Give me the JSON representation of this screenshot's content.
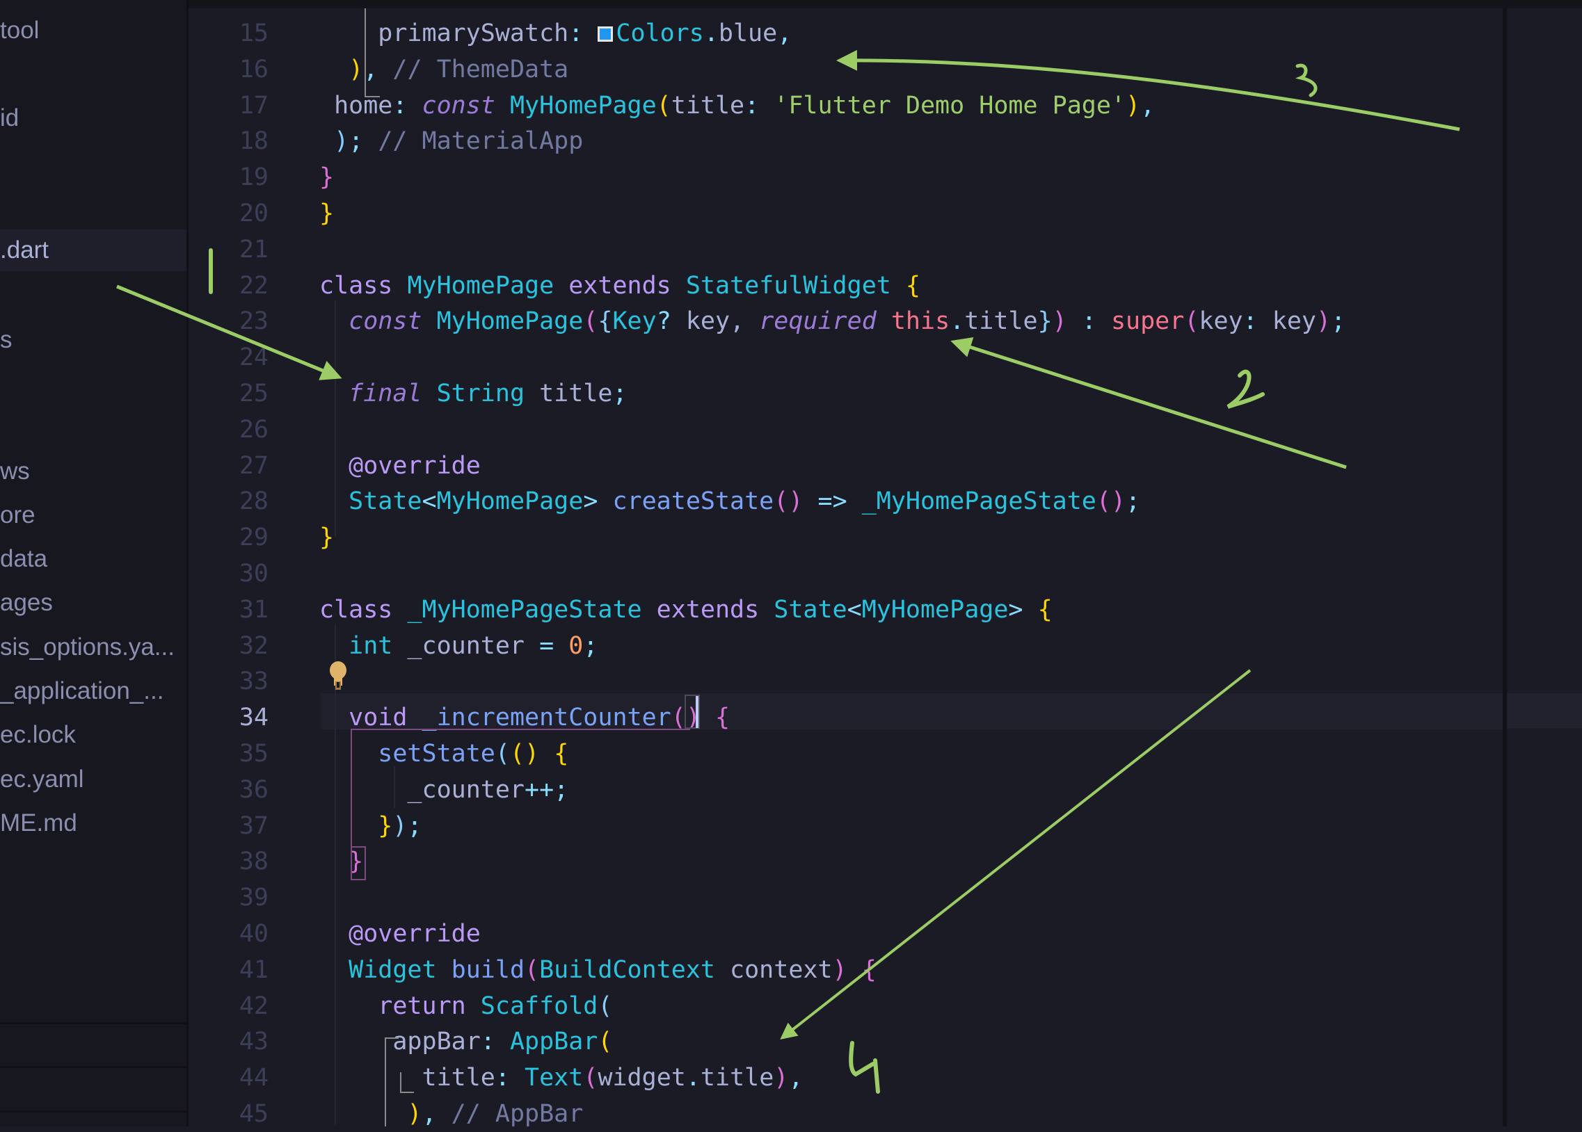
{
  "sidebar": {
    "items": [
      {
        "label": "tool",
        "selected": false
      },
      {
        "label": "id",
        "selected": false
      },
      {
        "label": ".dart",
        "selected": true
      },
      {
        "label": "s",
        "selected": false
      },
      {
        "label": "ws",
        "selected": false
      },
      {
        "label": "ore",
        "selected": false
      },
      {
        "label": "data",
        "selected": false
      },
      {
        "label": "ages",
        "selected": false
      },
      {
        "label": "sis_options.ya...",
        "selected": false
      },
      {
        "label": "_application_...",
        "selected": false
      },
      {
        "label": "ec.lock",
        "selected": false
      },
      {
        "label": "ec.yaml",
        "selected": false
      },
      {
        "label": "ME.md",
        "selected": false
      }
    ]
  },
  "editor": {
    "current_line": 34,
    "lines": [
      {
        "n": "15"
      },
      {
        "n": "16"
      },
      {
        "n": "17"
      },
      {
        "n": "18"
      },
      {
        "n": "19"
      },
      {
        "n": "20"
      },
      {
        "n": "21"
      },
      {
        "n": "22"
      },
      {
        "n": "23"
      },
      {
        "n": "24"
      },
      {
        "n": "25"
      },
      {
        "n": "26"
      },
      {
        "n": "27"
      },
      {
        "n": "28"
      },
      {
        "n": "29"
      },
      {
        "n": "30"
      },
      {
        "n": "31"
      },
      {
        "n": "32"
      },
      {
        "n": "33"
      },
      {
        "n": "34"
      },
      {
        "n": "35"
      },
      {
        "n": "36"
      },
      {
        "n": "37"
      },
      {
        "n": "38"
      },
      {
        "n": "39"
      },
      {
        "n": "40"
      },
      {
        "n": "41"
      },
      {
        "n": "42"
      },
      {
        "n": "43"
      },
      {
        "n": "44"
      },
      {
        "n": "45"
      }
    ],
    "code": {
      "l15": [
        [
          "",
          "    primarySwatch"
        ],
        [
          "pn",
          ": "
        ],
        [
          "swatch",
          ""
        ],
        [
          "ty",
          "Colors"
        ],
        [
          "pn",
          "."
        ],
        [
          "",
          "blue"
        ],
        [
          "pn",
          ","
        ]
      ],
      "l16": [
        [
          "p1",
          "  )"
        ],
        [
          "pn",
          ", "
        ],
        [
          "cm",
          "// ThemeData"
        ]
      ],
      "l17": [
        [
          "",
          " home"
        ],
        [
          "pn",
          ": "
        ],
        [
          "kwi",
          "const"
        ],
        [
          "",
          " "
        ],
        [
          "ty",
          "MyHomePage"
        ],
        [
          "p1",
          "("
        ],
        [
          "",
          "title"
        ],
        [
          "pn",
          ": "
        ],
        [
          "str",
          "'Flutter Demo Home Page'"
        ],
        [
          "p1",
          ")"
        ],
        [
          "pn",
          ","
        ]
      ],
      "l18": [
        [
          "p3",
          " )"
        ],
        [
          "pn",
          "; "
        ],
        [
          "cm",
          "// MaterialApp"
        ]
      ],
      "l19": [
        [
          "p2",
          "}"
        ]
      ],
      "l20": [
        [
          "p1",
          "}"
        ]
      ],
      "l21": [],
      "l22": [
        [
          "kw",
          "class"
        ],
        [
          "",
          " "
        ],
        [
          "ty",
          "MyHomePage"
        ],
        [
          "",
          " "
        ],
        [
          "kw",
          "extends"
        ],
        [
          "",
          " "
        ],
        [
          "ty",
          "StatefulWidget"
        ],
        [
          "",
          " "
        ],
        [
          "p1",
          "{"
        ]
      ],
      "l23": [
        [
          "kwi",
          "  const"
        ],
        [
          "",
          " "
        ],
        [
          "ty",
          "MyHomePage"
        ],
        [
          "p2",
          "("
        ],
        [
          "p3",
          "{"
        ],
        [
          "ty",
          "Key"
        ],
        [
          "pn",
          "?"
        ],
        [
          "",
          " key, "
        ],
        [
          "kwi",
          "required"
        ],
        [
          "",
          " "
        ],
        [
          "red",
          "this"
        ],
        [
          "pn",
          "."
        ],
        [
          "",
          "title"
        ],
        [
          "p3",
          "}"
        ],
        [
          "p2",
          ")"
        ],
        [
          "pn",
          " : "
        ],
        [
          "red",
          "super"
        ],
        [
          "p2",
          "("
        ],
        [
          "",
          "key"
        ],
        [
          "pn",
          ": "
        ],
        [
          "",
          "key"
        ],
        [
          "p2",
          ")"
        ],
        [
          "pn",
          ";"
        ]
      ],
      "l24": [],
      "l25": [
        [
          "kwi",
          "  final"
        ],
        [
          "",
          " "
        ],
        [
          "ty",
          "String"
        ],
        [
          "",
          " title"
        ],
        [
          "pn",
          ";"
        ]
      ],
      "l26": [],
      "l27": [
        [
          "kw",
          "  @override"
        ]
      ],
      "l28": [
        [
          "ty",
          "  State"
        ],
        [
          "pn",
          "<"
        ],
        [
          "ty",
          "MyHomePage"
        ],
        [
          "pn",
          ">"
        ],
        [
          "",
          " "
        ],
        [
          "fn",
          "createState"
        ],
        [
          "p2",
          "()"
        ],
        [
          "pn",
          " => "
        ],
        [
          "ty",
          "_MyHomePageState"
        ],
        [
          "p2",
          "()"
        ],
        [
          "pn",
          ";"
        ]
      ],
      "l29": [
        [
          "p1",
          "}"
        ]
      ],
      "l30": [],
      "l31": [
        [
          "kw",
          "class"
        ],
        [
          "",
          " "
        ],
        [
          "ty",
          "_MyHomePageState"
        ],
        [
          "",
          " "
        ],
        [
          "kw",
          "extends"
        ],
        [
          "",
          " "
        ],
        [
          "ty",
          "State"
        ],
        [
          "pn",
          "<"
        ],
        [
          "ty",
          "MyHomePage"
        ],
        [
          "pn",
          ">"
        ],
        [
          "",
          " "
        ],
        [
          "p1",
          "{"
        ]
      ],
      "l32": [
        [
          "ty",
          "  int"
        ],
        [
          "",
          " _counter "
        ],
        [
          "pn",
          "="
        ],
        [
          "",
          " "
        ],
        [
          "num",
          "0"
        ],
        [
          "pn",
          ";"
        ]
      ],
      "l33": [],
      "l34": [
        [
          "kw",
          "  void"
        ],
        [
          "",
          " "
        ],
        [
          "fn",
          "_incrementCounter"
        ],
        [
          "p2",
          "()"
        ],
        [
          "",
          " "
        ],
        [
          "p2",
          "{"
        ]
      ],
      "l35": [
        [
          "fn",
          "    setState"
        ],
        [
          "p3",
          "("
        ],
        [
          "p1",
          "()"
        ],
        [
          "",
          " "
        ],
        [
          "p1",
          "{"
        ]
      ],
      "l36": [
        [
          "",
          "      _counter"
        ],
        [
          "pn",
          "++;"
        ]
      ],
      "l37": [
        [
          "p1",
          "    }"
        ],
        [
          "p3",
          ")"
        ],
        [
          "pn",
          ";"
        ]
      ],
      "l38": [
        [
          "p2",
          "  }"
        ]
      ],
      "l39": [],
      "l40": [
        [
          "kw",
          "  @override"
        ]
      ],
      "l41": [
        [
          "ty",
          "  Widget"
        ],
        [
          "",
          " "
        ],
        [
          "fn",
          "build"
        ],
        [
          "p2",
          "("
        ],
        [
          "ty",
          "BuildContext"
        ],
        [
          "",
          " context"
        ],
        [
          "p2",
          ")"
        ],
        [
          "",
          " "
        ],
        [
          "p2",
          "{"
        ]
      ],
      "l42": [
        [
          "kw",
          "    return"
        ],
        [
          "",
          " "
        ],
        [
          "ty",
          "Scaffold"
        ],
        [
          "p3",
          "("
        ]
      ],
      "l43": [
        [
          "",
          "     appBar"
        ],
        [
          "pn",
          ": "
        ],
        [
          "ty",
          "AppBar"
        ],
        [
          "p1",
          "("
        ]
      ],
      "l44": [
        [
          "",
          "       title"
        ],
        [
          "pn",
          ": "
        ],
        [
          "ty",
          "Text"
        ],
        [
          "p2",
          "("
        ],
        [
          "",
          "widget"
        ],
        [
          "pn",
          "."
        ],
        [
          "",
          "title"
        ],
        [
          "p2",
          ")"
        ],
        [
          "pn",
          ","
        ]
      ],
      "l45": [
        [
          "p1",
          "      )"
        ],
        [
          "pn",
          ", "
        ],
        [
          "cm",
          "// AppBar"
        ]
      ]
    },
    "lightbulb": "lightbulb-icon"
  },
  "annotations": {
    "color": "#9ccc65",
    "labels": [
      {
        "id": "1",
        "text": "|"
      },
      {
        "id": "2",
        "text": "2"
      },
      {
        "id": "3",
        "text": "3"
      },
      {
        "id": "4",
        "text": "4"
      }
    ]
  },
  "colors": {
    "background": "#1b1b26",
    "sidebar": "#17171f",
    "annotation": "#9ccc65"
  }
}
